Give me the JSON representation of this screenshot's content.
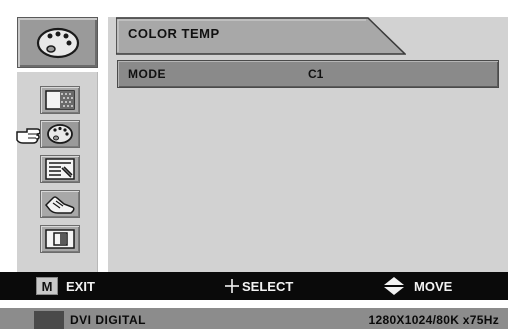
{
  "menu": {
    "current_tab": "COLOR TEMP",
    "row": {
      "label": "MODE",
      "value": "C1"
    }
  },
  "sidebar": {
    "items": [
      {
        "icon": "brightness-contrast-icon"
      },
      {
        "icon": "palette-icon",
        "selected": true
      },
      {
        "icon": "adjust-image-icon"
      },
      {
        "icon": "setup-hand-icon"
      },
      {
        "icon": "picture-position-icon"
      }
    ]
  },
  "help_bar": {
    "m_key": "M",
    "exit": "EXIT",
    "select": "SELECT",
    "move": "MOVE"
  },
  "status": {
    "input": "DVI DIGITAL",
    "resolution": "1280X1024/80K x75Hz"
  },
  "colors": {
    "panel": "#d2d2d2",
    "highlight": "#8a8a8a",
    "help_bar": "#0a0a0a",
    "status_bar": "#8c8c8c"
  }
}
